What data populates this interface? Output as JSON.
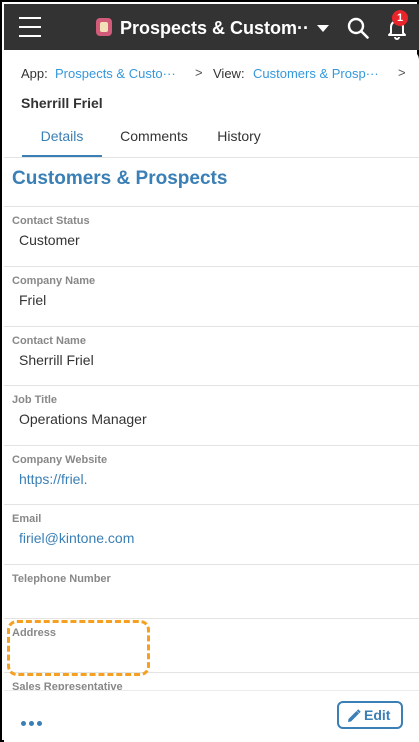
{
  "header": {
    "app_title": "Prospects & Custom···",
    "notification_count": "1",
    "colors": {
      "bar": "#333333",
      "badge": "#e8252a",
      "accent": "#3a7fb5"
    }
  },
  "breadcrumb": {
    "app_prefix": "App:",
    "app_link": "Prospects & Custo···",
    "separator": ">",
    "view_prefix": "View:",
    "view_link": "Customers & Prosp···"
  },
  "record": {
    "title": "Sherrill Friel"
  },
  "tabs": [
    {
      "label": "Details",
      "active": true
    },
    {
      "label": "Comments",
      "active": false
    },
    {
      "label": "History",
      "active": false
    }
  ],
  "section": {
    "title": "Customers & Prospects"
  },
  "fields": [
    {
      "label": "Contact Status",
      "value": "Customer"
    },
    {
      "label": "Company Name",
      "value": "Friel"
    },
    {
      "label": "Contact Name",
      "value": "Sherrill Friel"
    },
    {
      "label": "Job Title",
      "value": "Operations Manager"
    },
    {
      "label": "Company Website",
      "value": "https://friel."
    },
    {
      "label": "Email",
      "value": "firiel@kintone.com"
    },
    {
      "label": "Telephone Number",
      "value": ""
    },
    {
      "label": "Address",
      "value": ""
    },
    {
      "label": "Sales Representative",
      "value": ""
    }
  ],
  "footer": {
    "edit_label": "Edit"
  }
}
